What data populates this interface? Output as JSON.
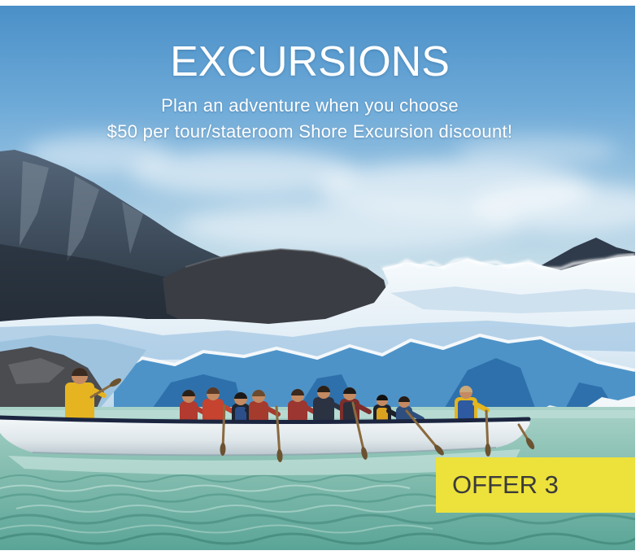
{
  "header": {
    "title": "EXCURSIONS",
    "subtitle_line1": "Plan an adventure when you choose",
    "subtitle_line2": "$50 per tour/stateroom Shore Excursion discount!"
  },
  "badge": {
    "label": "OFFER 3"
  },
  "colors": {
    "frame": "#ffffff",
    "title_text": "#ffffff",
    "badge_background": "#ede23b",
    "badge_text": "#3b3b3b"
  }
}
